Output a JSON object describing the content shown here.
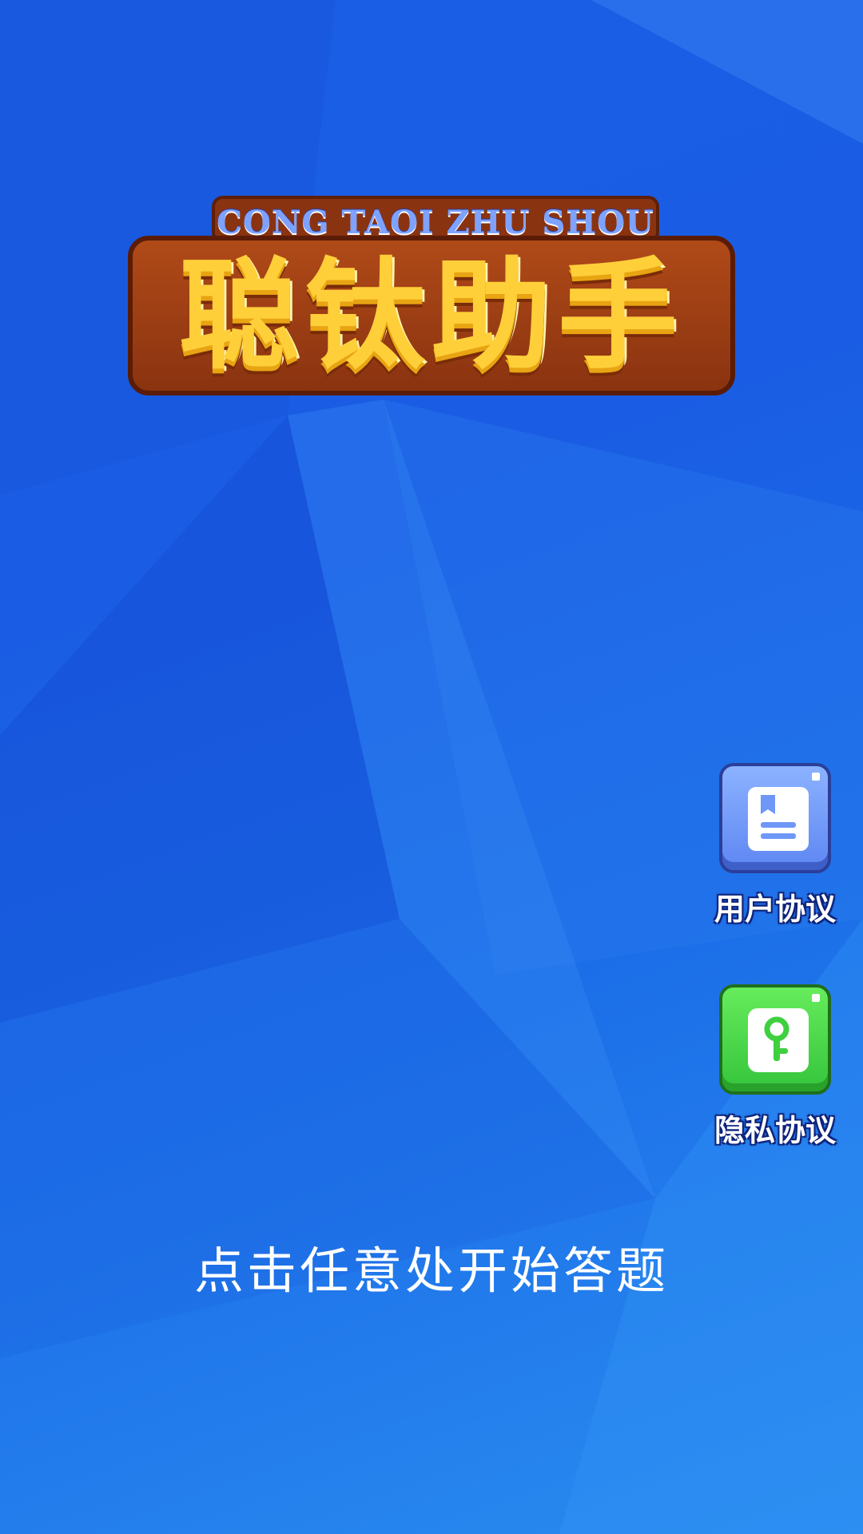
{
  "logo": {
    "subtitle": "CONG TAOI ZHU SHOU",
    "title": "聪钛助手"
  },
  "side_buttons": [
    {
      "label": "用户协议",
      "icon": "document-icon",
      "color": "#6f97f8"
    },
    {
      "label": "隐私协议",
      "icon": "key-lock-icon",
      "color": "#48d848"
    }
  ],
  "prompt": "点击任意处开始答题",
  "colors": {
    "background": "#1a5ee6",
    "logo_gold": "#ffcf3a",
    "logo_frame": "#8a3311"
  }
}
